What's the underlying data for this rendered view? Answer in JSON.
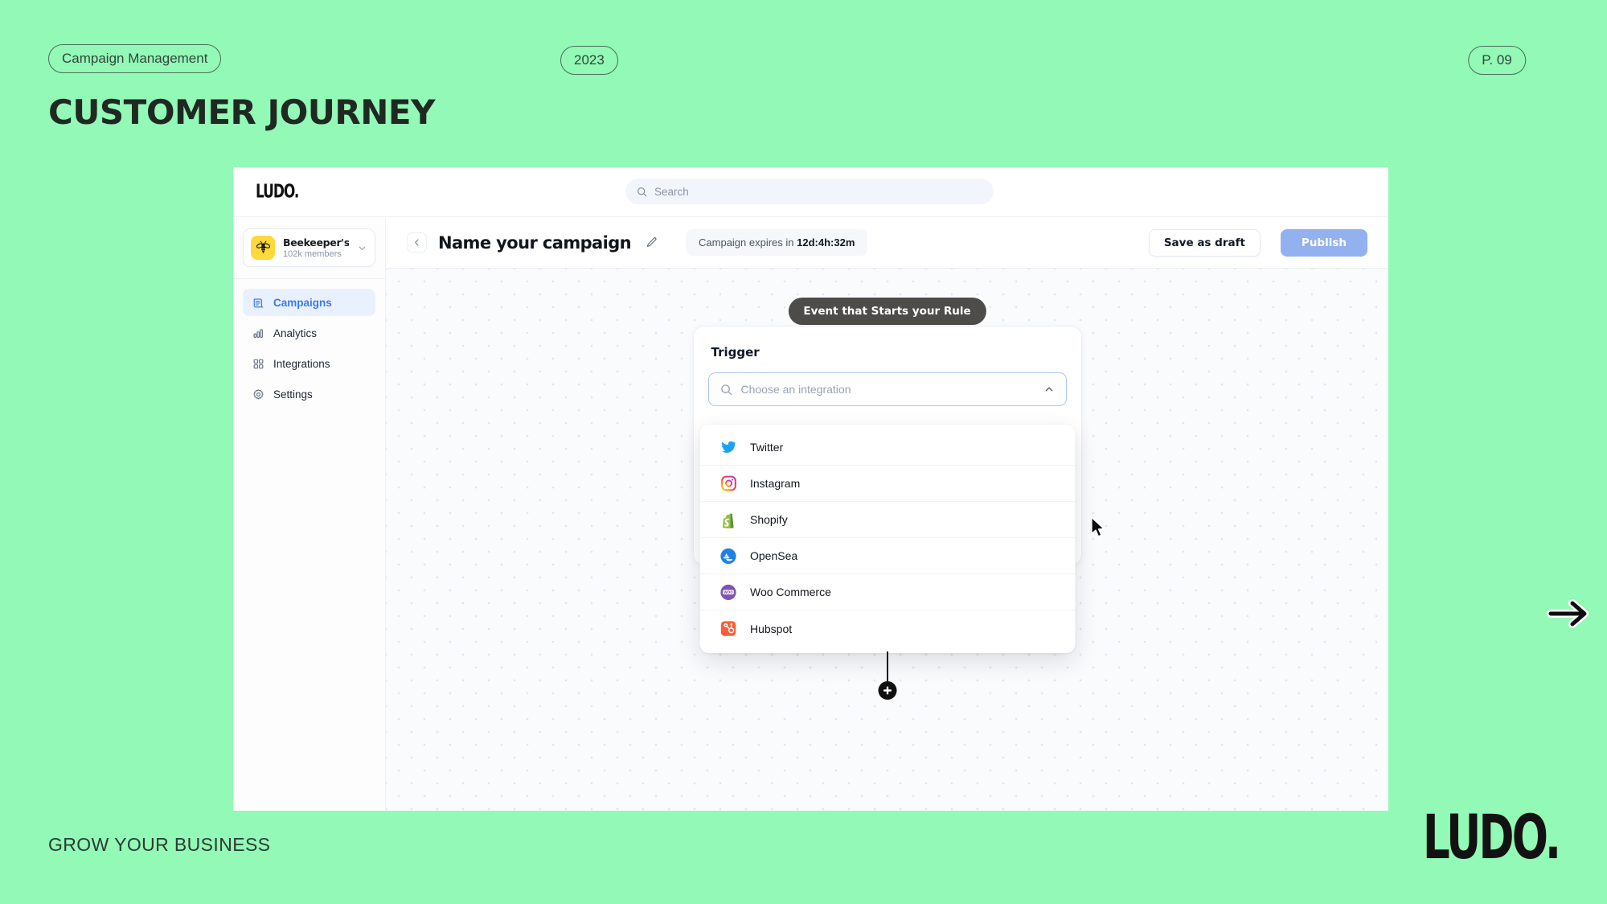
{
  "slide": {
    "tag": "Campaign Management",
    "year": "2023",
    "page": "P. 09",
    "title": "CUSTOMER JOURNEY",
    "footer": "GROW YOUR BUSINESS",
    "brand": "LUDO.",
    "next_icon": "arrow-right-icon",
    "background_color": "#92f9b6",
    "text_color": "#1f2922"
  },
  "app": {
    "logo": "LUDO.",
    "search": {
      "placeholder": "Search",
      "icon": "search-icon"
    },
    "sidebar": {
      "workspace": {
        "name": "Beekeeper's Na...",
        "members": "102k members",
        "avatar_icon": "bee-icon",
        "avatar_color": "#ffd93b",
        "caret_icon": "chevron-down-icon"
      },
      "items": [
        {
          "label": "Campaigns",
          "icon": "campaigns-icon",
          "active": true
        },
        {
          "label": "Analytics",
          "icon": "bar-chart-icon",
          "active": false
        },
        {
          "label": "Integrations",
          "icon": "grid-squares-icon",
          "active": false
        },
        {
          "label": "Settings",
          "icon": "gear-icon",
          "active": false
        }
      ],
      "active_color": "#3b7af0"
    },
    "toolbar": {
      "back_icon": "chevron-left-icon",
      "title": "Name your campaign",
      "edit_icon": "pencil-icon",
      "expires_prefix": "Campaign expires in",
      "expires_value": "12d:4h:32m",
      "save_label": "Save as draft",
      "publish_label": "Publish",
      "publish_color": "#93b0ef"
    },
    "canvas": {
      "node_label": "Event that Starts your Rule",
      "trigger": {
        "heading": "Trigger",
        "combo_placeholder": "Choose an integration",
        "combo_search_icon": "search-icon",
        "combo_caret_icon": "chevron-up-icon",
        "focus_color": "#a9c6f5"
      },
      "dropdown_options": [
        {
          "label": "Twitter",
          "icon": "twitter-icon"
        },
        {
          "label": "Instagram",
          "icon": "instagram-icon"
        },
        {
          "label": "Shopify",
          "icon": "shopify-icon"
        },
        {
          "label": "OpenSea",
          "icon": "opensea-icon"
        },
        {
          "label": "Woo Commerce",
          "icon": "woocommerce-icon"
        },
        {
          "label": "Hubspot",
          "icon": "hubspot-icon"
        }
      ],
      "add_node_label": "+",
      "cursor_icon": "mouse-pointer-icon"
    }
  }
}
